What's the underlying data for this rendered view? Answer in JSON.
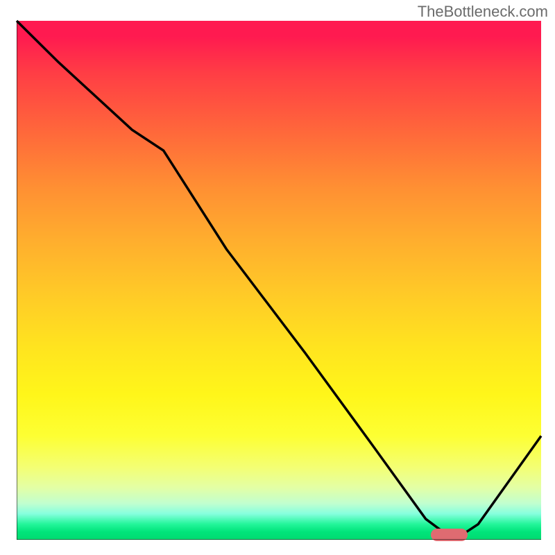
{
  "watermark": "TheBottleneck.com",
  "chart_data": {
    "type": "line",
    "title": "",
    "xlabel": "",
    "ylabel": "",
    "xlim": [
      0,
      100
    ],
    "ylim": [
      0,
      100
    ],
    "grid": false,
    "legend": false,
    "gradient_stops": [
      {
        "pct": 0,
        "color": "#ff1a50"
      },
      {
        "pct": 25,
        "color": "#ff7d36"
      },
      {
        "pct": 50,
        "color": "#ffc828"
      },
      {
        "pct": 75,
        "color": "#fbff3a"
      },
      {
        "pct": 92,
        "color": "#c1ffcf"
      },
      {
        "pct": 100,
        "color": "#00db72"
      }
    ],
    "series": [
      {
        "name": "bottleneck-curve",
        "color": "#000000",
        "x": [
          0,
          8,
          22,
          28,
          40,
          55,
          68,
          78,
          82,
          85,
          88,
          100
        ],
        "y": [
          100,
          92,
          79,
          75,
          56,
          36,
          18,
          4,
          1,
          1,
          3,
          20
        ]
      }
    ],
    "marker": {
      "name": "optimal-range",
      "x_start": 79,
      "x_end": 86,
      "y": 1,
      "color": "#df6b71"
    }
  }
}
